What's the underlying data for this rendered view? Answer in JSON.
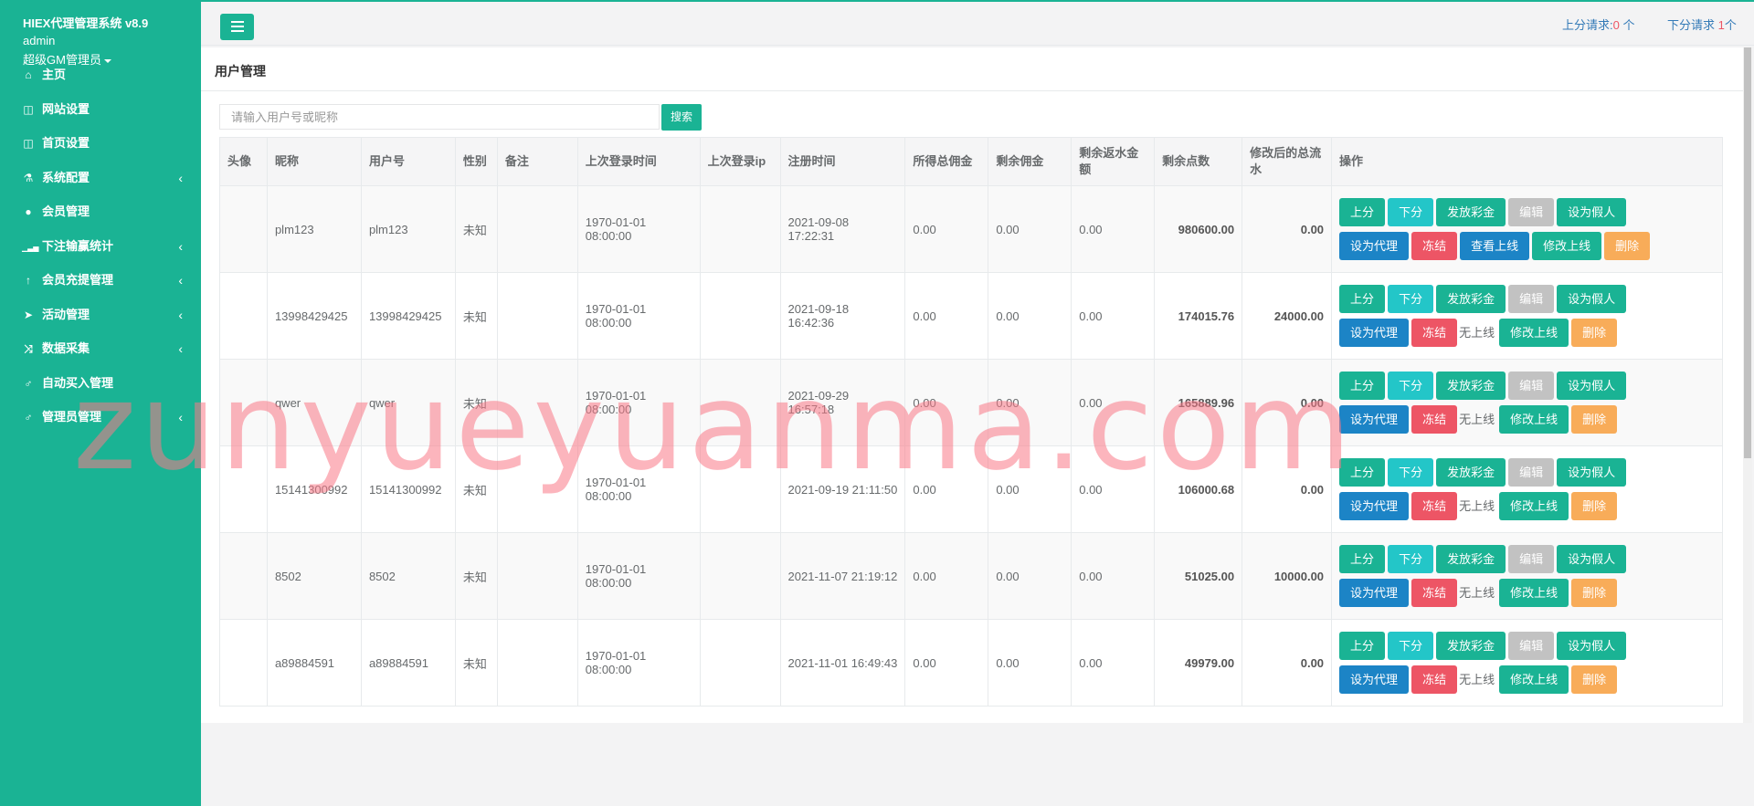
{
  "app": {
    "brand": "HIEX代理管理系统 v8.9",
    "user": "admin",
    "role": "超级GM管理员"
  },
  "sidebar": {
    "items": [
      {
        "label": "主页",
        "icon": "home-icon",
        "has_children": false
      },
      {
        "label": "网站设置",
        "icon": "columns-icon",
        "has_children": false
      },
      {
        "label": "首页设置",
        "icon": "columns-icon",
        "has_children": false
      },
      {
        "label": "系统配置",
        "icon": "flask-icon",
        "has_children": true
      },
      {
        "label": "会员管理",
        "icon": "user-icon",
        "has_children": false
      },
      {
        "label": "下注输赢统计",
        "icon": "bar-chart-icon",
        "has_children": true
      },
      {
        "label": "会员充提管理",
        "icon": "level-up-icon",
        "has_children": true
      },
      {
        "label": "活动管理",
        "icon": "paper-plane-icon",
        "has_children": true
      },
      {
        "label": "数据采集",
        "icon": "random-icon",
        "has_children": true
      },
      {
        "label": "自动买入管理",
        "icon": "male-icon",
        "has_children": false
      },
      {
        "label": "管理员管理",
        "icon": "male-icon",
        "has_children": true
      }
    ]
  },
  "topbar": {
    "up_request_label": "上分请求:",
    "up_request_count": "0",
    "up_request_unit": " 个",
    "down_request_label": "下分请求 ",
    "down_request_count": "1",
    "down_request_unit": "个"
  },
  "page": {
    "title": "用户管理",
    "search_placeholder": "请输入用户号或昵称",
    "search_button": "搜索"
  },
  "table": {
    "headers": [
      "头像",
      "昵称",
      "用户号",
      "性别",
      "备注",
      "上次登录时间",
      "上次登录ip",
      "注册时间",
      "所得总佣金",
      "剩余佣金",
      "剩余返水金额",
      "剩余点数",
      "修改后的总流水",
      "操作"
    ],
    "rows": [
      {
        "nickname": "plm123",
        "uid": "plm123",
        "gender": "未知",
        "note": "",
        "last_login": "1970-01-01 08:00:00",
        "last_ip": "",
        "reg_time": "2021-09-08 17:22:31",
        "total_comm": "0.00",
        "remain_comm": "0.00",
        "rebate": "0.00",
        "points": "980600.00",
        "flow": "0.00",
        "upline": "查看上线"
      },
      {
        "nickname": "13998429425",
        "uid": "13998429425",
        "gender": "未知",
        "note": "",
        "last_login": "1970-01-01 08:00:00",
        "last_ip": "",
        "reg_time": "2021-09-18 16:42:36",
        "total_comm": "0.00",
        "remain_comm": "0.00",
        "rebate": "0.00",
        "points": "174015.76",
        "flow": "24000.00",
        "upline": "无上线"
      },
      {
        "nickname": "qwer",
        "uid": "qwer",
        "gender": "未知",
        "note": "",
        "last_login": "1970-01-01 08:00:00",
        "last_ip": "",
        "reg_time": "2021-09-29 16:57:18",
        "total_comm": "0.00",
        "remain_comm": "0.00",
        "rebate": "0.00",
        "points": "165889.96",
        "flow": "0.00",
        "upline": "无上线"
      },
      {
        "nickname": "15141300992",
        "uid": "15141300992",
        "gender": "未知",
        "note": "",
        "last_login": "1970-01-01 08:00:00",
        "last_ip": "",
        "reg_time": "2021-09-19 21:11:50",
        "total_comm": "0.00",
        "remain_comm": "0.00",
        "rebate": "0.00",
        "points": "106000.68",
        "flow": "0.00",
        "upline": "无上线"
      },
      {
        "nickname": "8502",
        "uid": "8502",
        "gender": "未知",
        "note": "",
        "last_login": "1970-01-01 08:00:00",
        "last_ip": "",
        "reg_time": "2021-11-07 21:19:12",
        "total_comm": "0.00",
        "remain_comm": "0.00",
        "rebate": "0.00",
        "points": "51025.00",
        "flow": "10000.00",
        "upline": "无上线"
      },
      {
        "nickname": "a89884591",
        "uid": "a89884591",
        "gender": "未知",
        "note": "",
        "last_login": "1970-01-01 08:00:00",
        "last_ip": "",
        "reg_time": "2021-11-01 16:49:43",
        "total_comm": "0.00",
        "remain_comm": "0.00",
        "rebate": "0.00",
        "points": "49979.00",
        "flow": "0.00",
        "upline": "无上线"
      }
    ],
    "actions": {
      "up": "上分",
      "down": "下分",
      "bonus": "发放彩金",
      "edit": "编辑",
      "fake": "设为假人",
      "agent": "设为代理",
      "freeze": "冻结",
      "modify_upline": "修改上线",
      "delete": "删除"
    }
  },
  "watermark": "zunyueyuanma.com",
  "colors": {
    "primary": "#1ab394",
    "info": "#23c6c8",
    "blue": "#1c84c6",
    "danger": "#ed5565",
    "warning": "#f8ac59",
    "muted": "#c2c2c2"
  }
}
